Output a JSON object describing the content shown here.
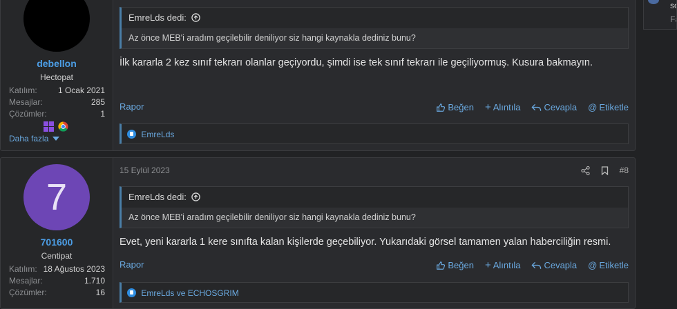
{
  "colors": {
    "accent": "#4c9ee6",
    "avatar2": "#6d46b5"
  },
  "sidebar_snippet": {
    "line1": "so",
    "line2": "Fa"
  },
  "posts": [
    {
      "user": {
        "name": "debellon",
        "title": "Hectopat",
        "stats": [
          {
            "label": "Katılım:",
            "value": "1 Ocak 2021"
          },
          {
            "label": "Mesajlar:",
            "value": "285"
          },
          {
            "label": "Çözümler:",
            "value": "1"
          }
        ],
        "more": "Daha fazla"
      },
      "quote": {
        "author": "EmreLds dedi:",
        "text": "Az önce MEB'i aradım geçilebilir deniliyor siz hangi kaynakla dediniz bunu?"
      },
      "body": "İlk kararla 2 kez sınıf tekrarı olanlar geçiyordu, şimdi ise tek sınıf tekrarı ile geçiliyormuş. Kusura bakmayın.",
      "actions": {
        "report": "Rapor",
        "like": "Beğen",
        "quote": "Alıntıla",
        "reply": "Cevapla",
        "tag": "Etiketle"
      },
      "reactions": "EmreLds"
    },
    {
      "date": "15 Eylül 2023",
      "post_no": "#8",
      "user": {
        "avatar_letter": "7",
        "name": "701600",
        "title": "Centipat",
        "stats": [
          {
            "label": "Katılım:",
            "value": "18 Ağustos 2023"
          },
          {
            "label": "Mesajlar:",
            "value": "1.710"
          },
          {
            "label": "Çözümler:",
            "value": "16"
          }
        ]
      },
      "quote": {
        "author": "EmreLds dedi:",
        "text": "Az önce MEB'i aradım geçilebilir deniliyor siz hangi kaynakla dediniz bunu?"
      },
      "body": "Evet, yeni kararla 1 kere sınıfta kalan kişilerde geçebiliyor. Yukarıdaki görsel tamamen yalan haberciliğin resmi.",
      "actions": {
        "report": "Rapor",
        "like": "Beğen",
        "quote": "Alıntıla",
        "reply": "Cevapla",
        "tag": "Etiketle"
      },
      "reactions": "EmreLds ve ECHOSGRIM"
    }
  ]
}
